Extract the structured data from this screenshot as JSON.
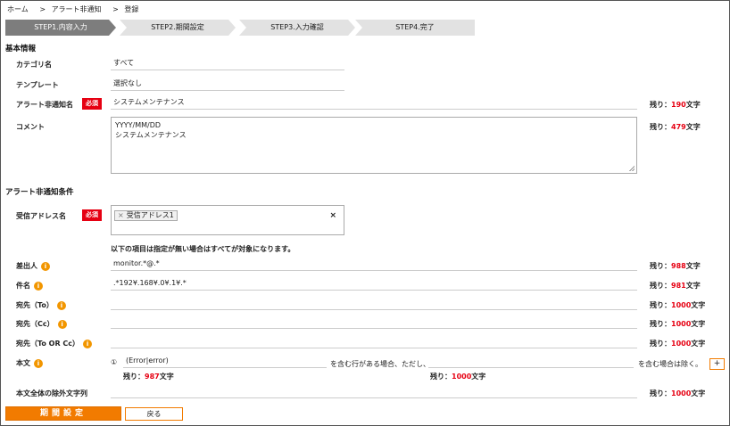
{
  "breadcrumb": {
    "home": "ホーム",
    "sep1": ">",
    "alert": "アラート非通知",
    "sep2": ">",
    "current": "登録"
  },
  "steps": [
    "STEP1.内容入力",
    "STEP2.期間設定",
    "STEP3.入力確認",
    "STEP4.完了"
  ],
  "basic": {
    "title": "基本情報",
    "category_label": "カテゴリ名",
    "category_value": "すべて",
    "template_label": "テンプレート",
    "template_value": "選択なし",
    "name_label": "アラート非通知名",
    "required": "必須",
    "name_value": "システムメンテナンス",
    "name_remain_prefix": "残り：",
    "name_remain": "190",
    "name_remain_suffix": "文字",
    "comment_label": "コメント",
    "comment_line1": "YYYY/MM/DD",
    "comment_line2": "システムメンテナンス",
    "comment_remain_prefix": "残り：",
    "comment_remain": "479",
    "comment_remain_suffix": "文字"
  },
  "conditions": {
    "title": "アラート非通知条件",
    "recipient_label": "受信アドレス名",
    "required": "必須",
    "recipient_tag_x": "×",
    "recipient_tag": "受信アドレス1",
    "recipient_clear": "×",
    "note": "以下の項目は指定が無い場合はすべてが対象になります。",
    "from_label": "差出人",
    "from_value": "monitor.*@.*",
    "from_remain": "988",
    "subject_label": "件名",
    "subject_value": ".*192¥.168¥.0¥.1¥.*",
    "subject_remain": "981",
    "to_label": "宛先（To）",
    "to_remain": "1000",
    "cc_label": "宛先（Cc）",
    "cc_remain": "1000",
    "tocc_label": "宛先（To OR Cc）",
    "tocc_remain": "1000",
    "body_label": "本文",
    "body_index": "①",
    "body_value1": "(Error|error)",
    "body_mid_text": "を含む行がある場合、ただし、",
    "body_end_text": "を含む場合は除く。",
    "body_plus": "+",
    "body_remain1": "987",
    "body_remain2": "1000",
    "exclude_label": "本文全体の除外文字列",
    "exclude_remain": "1000",
    "remain_prefix": "残り：",
    "remain_suffix": "文字"
  },
  "info_glyph": "i",
  "buttons": {
    "period": "期間設定",
    "back": "戻る"
  },
  "colors": {
    "accent": "#f27b00",
    "required": "#e60012",
    "remain_number": "#e60012",
    "info_icon": "#f29600",
    "step_active": "#7d7d7d",
    "step_inactive": "#e2e2e2"
  }
}
